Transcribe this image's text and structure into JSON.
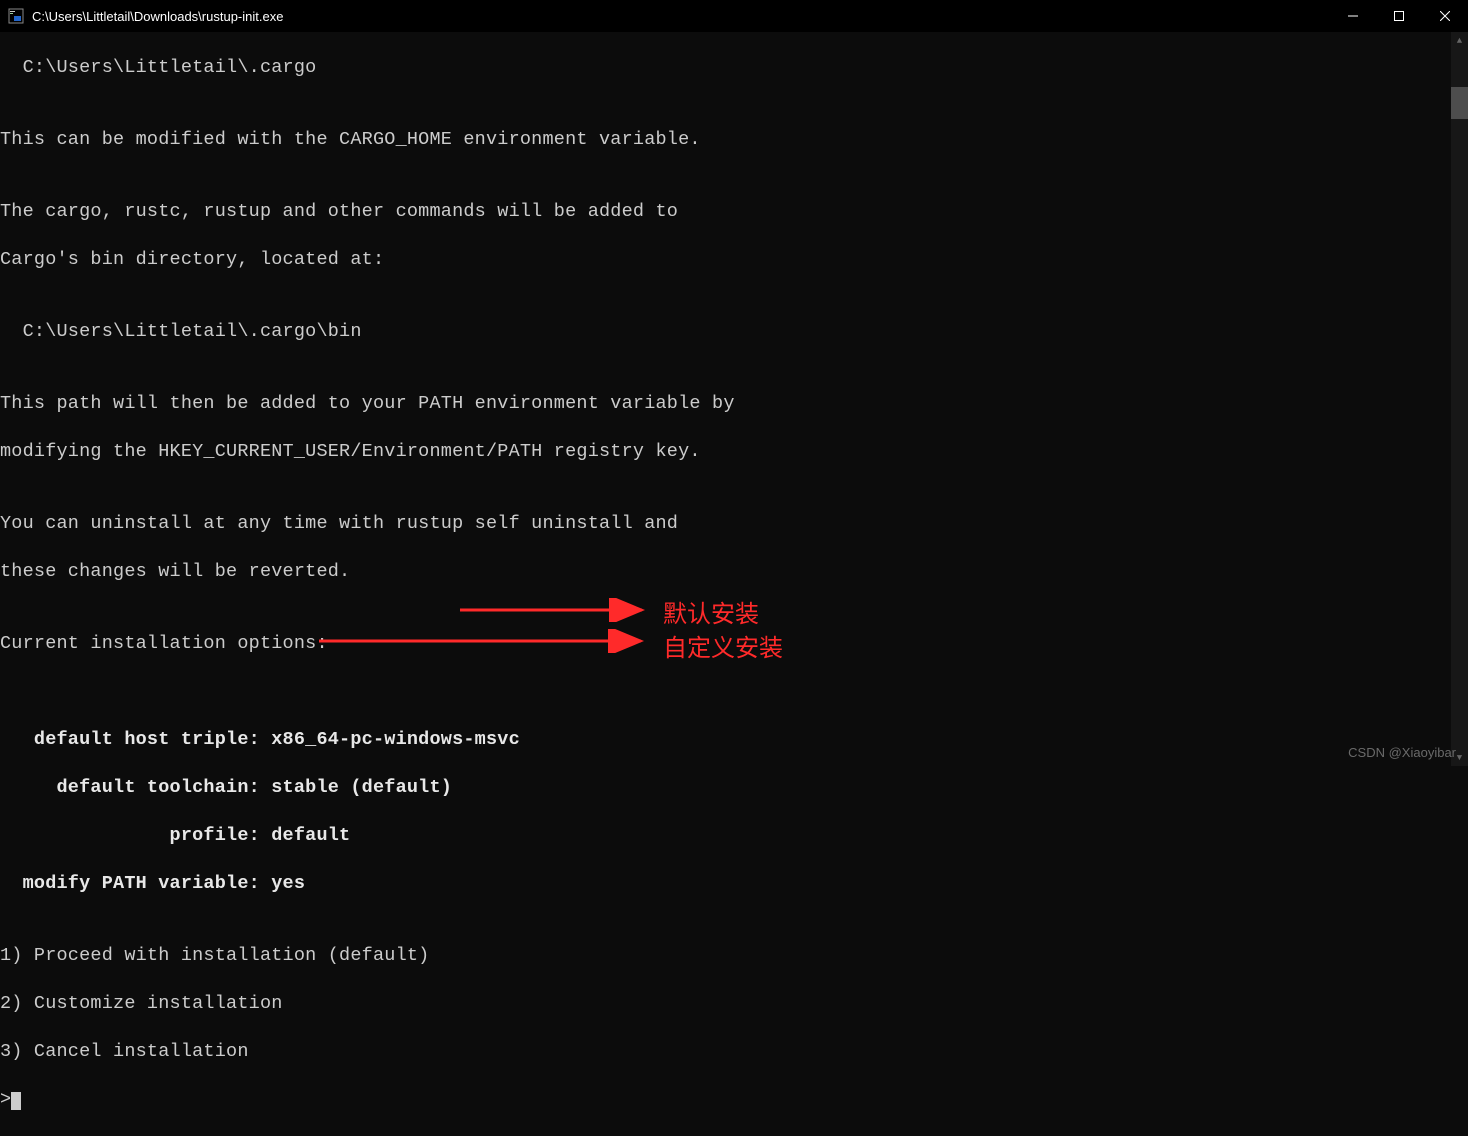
{
  "titlebar": {
    "path": "C:\\Users\\Littletail\\Downloads\\rustup-init.exe"
  },
  "terminal": {
    "line1": "  C:\\Users\\Littletail\\.cargo",
    "line2": "",
    "line3": "This can be modified with the CARGO_HOME environment variable.",
    "line4": "",
    "line5": "The cargo, rustc, rustup and other commands will be added to",
    "line6": "Cargo's bin directory, located at:",
    "line7": "",
    "line8": "  C:\\Users\\Littletail\\.cargo\\bin",
    "line9": "",
    "line10": "This path will then be added to your PATH environment variable by",
    "line11": "modifying the HKEY_CURRENT_USER/Environment/PATH registry key.",
    "line12": "",
    "line13": "You can uninstall at any time with rustup self uninstall and",
    "line14": "these changes will be reverted.",
    "line15": "",
    "line16": "Current installation options:",
    "line17": "",
    "line18": "",
    "opt1": "   default host triple: x86_64-pc-windows-msvc",
    "opt2": "     default toolchain: stable (default)",
    "opt3": "               profile: default",
    "opt4": "  modify PATH variable: yes",
    "line23": "",
    "choice1": "1) Proceed with installation (default)",
    "choice2": "2) Customize installation",
    "choice3": "3) Cancel installation",
    "prompt": ">"
  },
  "annotations": {
    "default_install": "默认安装",
    "custom_install": "自定义安装"
  },
  "watermark": "CSDN @Xiaoyibar"
}
